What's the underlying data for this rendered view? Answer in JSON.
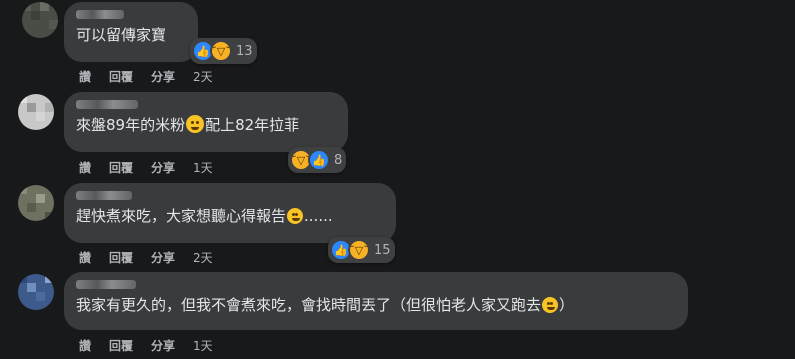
{
  "actions": {
    "like": "讚",
    "reply": "回覆",
    "share": "分享"
  },
  "comments": [
    {
      "text": "可以留傳家寶",
      "reaction_count": "13",
      "time": "2天"
    },
    {
      "text_before": "來盤89年的米粉",
      "text_after": "配上82年拉菲",
      "reaction_count": "8",
      "time": "1天"
    },
    {
      "text": "趕快煮來吃，大家想聽心得報告",
      "text_after": "......",
      "reaction_count": "15",
      "time": "2天"
    },
    {
      "text": "我家有更久的，但我不會煮來吃，會找時間丟了（但很怕老人家又跑去",
      "text_after": "）",
      "time": "1天"
    }
  ]
}
